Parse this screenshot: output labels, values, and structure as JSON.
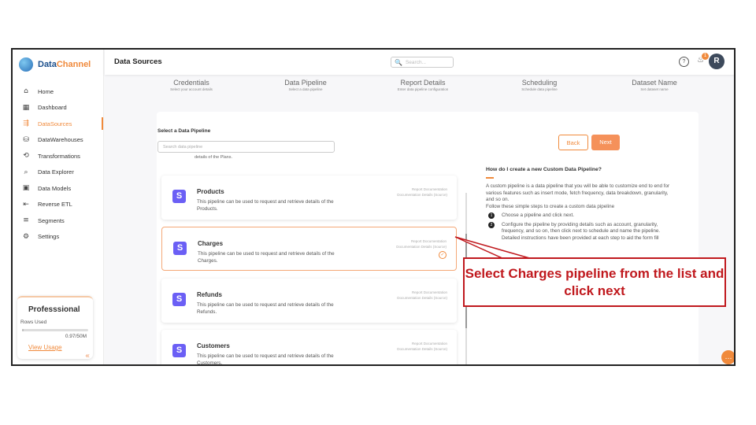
{
  "brand": {
    "name_part1": "Data",
    "name_part2": "Channel"
  },
  "sidebar": {
    "items": [
      {
        "label": "Home",
        "icon": "⌂",
        "icon_name": "home-icon"
      },
      {
        "label": "Dashboard",
        "icon": "▦",
        "icon_name": "dashboard-icon"
      },
      {
        "label": "DataSources",
        "icon": "⇶",
        "icon_name": "datasources-icon",
        "active": true
      },
      {
        "label": "DataWarehouses",
        "icon": "⛁",
        "icon_name": "datawarehouse-icon"
      },
      {
        "label": "Transformations",
        "icon": "⟲",
        "icon_name": "transformations-icon"
      },
      {
        "label": "Data Explorer",
        "icon": "⌕",
        "icon_name": "data-explorer-icon"
      },
      {
        "label": "Data Models",
        "icon": "▣",
        "icon_name": "data-models-icon"
      },
      {
        "label": "Reverse ETL",
        "icon": "⇤",
        "icon_name": "reverse-etl-icon"
      },
      {
        "label": "Segments",
        "icon": "≡",
        "icon_name": "segments-icon"
      },
      {
        "label": "Settings",
        "icon": "⚙",
        "icon_name": "settings-icon"
      }
    ],
    "plan": {
      "title": "Professsional",
      "rows_label": "Rows Used",
      "rows_value": "0.97/50M",
      "usage_fraction": 0.02,
      "link": "View Usage"
    },
    "collapse_icon": "«"
  },
  "header": {
    "title": "Data Sources",
    "search_placeholder": "Search...",
    "help_icon": "?",
    "bell_icon": "🔔",
    "notification_count": "1",
    "avatar_initial": "R"
  },
  "stepper": [
    {
      "title": "Credentials",
      "sub": "Select your account details"
    },
    {
      "title": "Data Pipeline",
      "sub": "Select a data pipeline"
    },
    {
      "title": "Report Details",
      "sub": "Enter data pipeline configuration"
    },
    {
      "title": "Scheduling",
      "sub": "Schedule data pipeline"
    },
    {
      "title": "Dataset Name",
      "sub": "Set dataset name"
    }
  ],
  "pipeline": {
    "label": "Select a Data Pipeline",
    "search_placeholder": "Search data pipeline",
    "partial_text": "details of the Plans.",
    "cards": [
      {
        "name": "Products",
        "desc": "This pipeline can be used to request and retrieve details of the Products.",
        "link1": "Report Documentation",
        "link2": "Documentation Details (Source)",
        "selected": false
      },
      {
        "name": "Charges",
        "desc": "This pipeline can be used to request and retrieve details of the Charges.",
        "link1": "Report Documentation",
        "link2": "Documentation Details (Source)",
        "selected": true
      },
      {
        "name": "Refunds",
        "desc": "This pipeline can be used to request and retrieve details of the Refunds.",
        "link1": "Report Documentation",
        "link2": "Documentation Details (Source)",
        "selected": false
      },
      {
        "name": "Customers",
        "desc": "This pipeline can be used to request and retrieve details of the Customers.",
        "link1": "Report Documentation",
        "link2": "Documentation Details (Source)",
        "selected": false
      }
    ],
    "card_icon_letter": "S",
    "check_icon": "✓"
  },
  "buttons": {
    "back": "Back",
    "next": "Next"
  },
  "help": {
    "question": "How do I create a new Custom Data Pipeline?",
    "intro": "A custom pipeline is a data pipeline that you will be able to customize end to end for various features such as insert mode, fetch frequency, data breakdown, granularity, and so on.",
    "follow": "Follow these simple steps to create a custom data pipeline",
    "steps": [
      {
        "num": "1",
        "text": "Choose a pipeline and click next."
      },
      {
        "num": "2",
        "text": "Configure the pipeline by providing details such as account, granularity, frequency, and so on, then click next to schedule and name the pipeline. Detailed instructions have been provided at each step to aid the form fill"
      }
    ]
  },
  "chat_icon": "…",
  "callout": {
    "text": "Select Charges pipeline from the list and click next"
  },
  "colors": {
    "accent": "#f08a3c",
    "callout": "#c0191e",
    "card_icon": "#6b5ff5"
  }
}
